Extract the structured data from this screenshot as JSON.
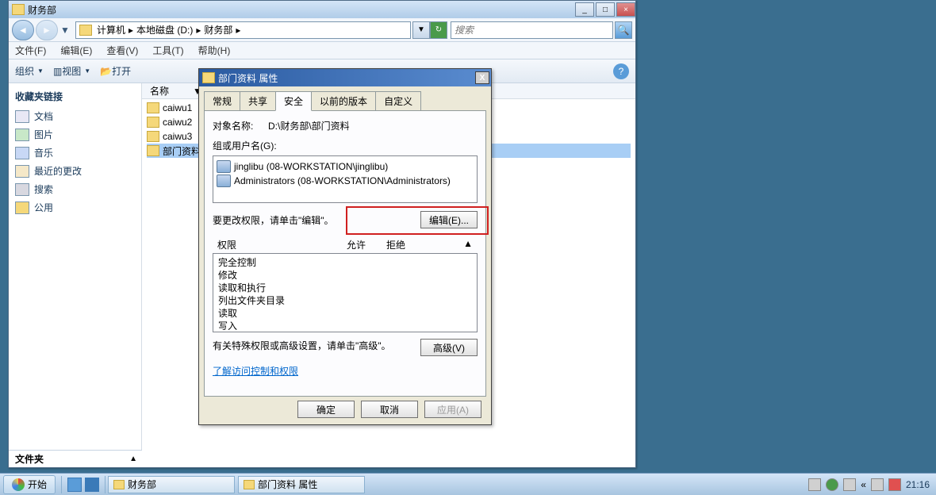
{
  "window_title": "财务部",
  "breadcrumbs": [
    "计算机",
    "本地磁盘 (D:)",
    "财务部"
  ],
  "search_placeholder": "搜索",
  "menus": {
    "file": "文件(F)",
    "edit": "编辑(E)",
    "view": "查看(V)",
    "tools": "工具(T)",
    "help": "帮助(H)"
  },
  "toolbar": {
    "org": "组织",
    "views": "视图",
    "open": "打开"
  },
  "sidebar": {
    "title": "收藏夹链接",
    "items": [
      {
        "label": "文档",
        "cls": "doc"
      },
      {
        "label": "图片",
        "cls": "pic"
      },
      {
        "label": "音乐",
        "cls": "music"
      },
      {
        "label": "最近的更改",
        "cls": "recent"
      },
      {
        "label": "搜索",
        "cls": "search"
      },
      {
        "label": "公用",
        "cls": "public"
      }
    ],
    "footer": "文件夹"
  },
  "filelist": {
    "header_name": "名称",
    "items": [
      "caiwu1",
      "caiwu2",
      "caiwu3",
      "部门资料"
    ]
  },
  "dialog": {
    "title": "部门资料 属性",
    "tabs": [
      "常规",
      "共享",
      "安全",
      "以前的版本",
      "自定义"
    ],
    "active_tab": 2,
    "object_label": "对象名称:",
    "object_value": "D:\\财务部\\部门资料",
    "groups_label": "组或用户名(G):",
    "groups": [
      "jinglibu (08-WORKSTATION\\jinglibu)",
      "Administrators (08-WORKSTATION\\Administrators)"
    ],
    "edit_text": "要更改权限，请单击\"编辑\"。",
    "edit_btn": "编辑(E)...",
    "perm_label": "权限",
    "perm_allow": "允许",
    "perm_deny": "拒绝",
    "perms": [
      "完全控制",
      "修改",
      "读取和执行",
      "列出文件夹目录",
      "读取",
      "写入"
    ],
    "adv_text": "有关特殊权限或高级设置，请单击\"高级\"。",
    "adv_btn": "高级(V)",
    "link": "了解访问控制和权限",
    "ok": "确定",
    "cancel": "取消",
    "apply": "应用(A)"
  },
  "taskbar": {
    "start": "开始",
    "tasks": [
      "财务部",
      "部门资料 属性"
    ],
    "clock": "21:16"
  }
}
